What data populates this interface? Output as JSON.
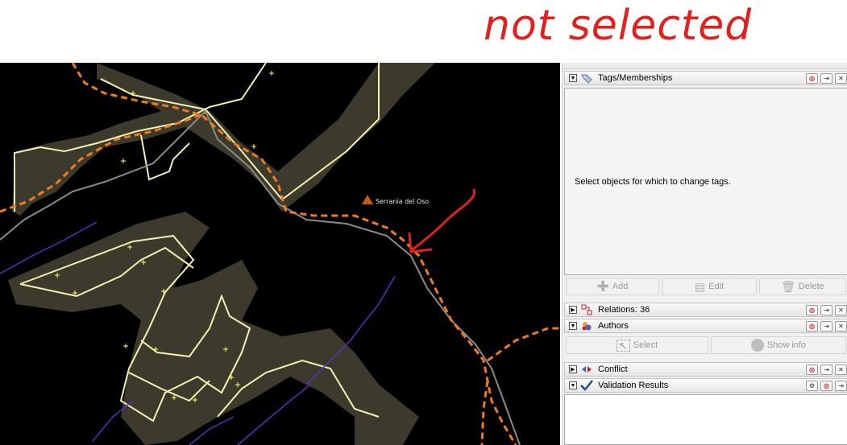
{
  "annotation": "not selected",
  "map": {
    "peak_label": "Serranía del Oso",
    "colors": {
      "background": "#000000",
      "ridge_fill": "#3b3a2c",
      "ridge_stroke": "#f4f0b0",
      "trail": "#f07a1e",
      "road": "#8a8a8a",
      "stream": "#5b2dbf",
      "peak": "#c85a16",
      "arrow": "#e0211d"
    }
  },
  "panel": {
    "tags": {
      "title": "Tags/Memberships",
      "empty_text": "Select objects for which to change tags.",
      "add_label": "Add",
      "edit_label": "Edit",
      "delete_label": "Delete"
    },
    "relations": {
      "title": "Relations: 36"
    },
    "authors": {
      "title": "Authors",
      "select_label": "Select",
      "show_info_label": "Show info"
    },
    "conflict": {
      "title": "Conflict"
    },
    "validation": {
      "title": "Validation Results"
    }
  }
}
